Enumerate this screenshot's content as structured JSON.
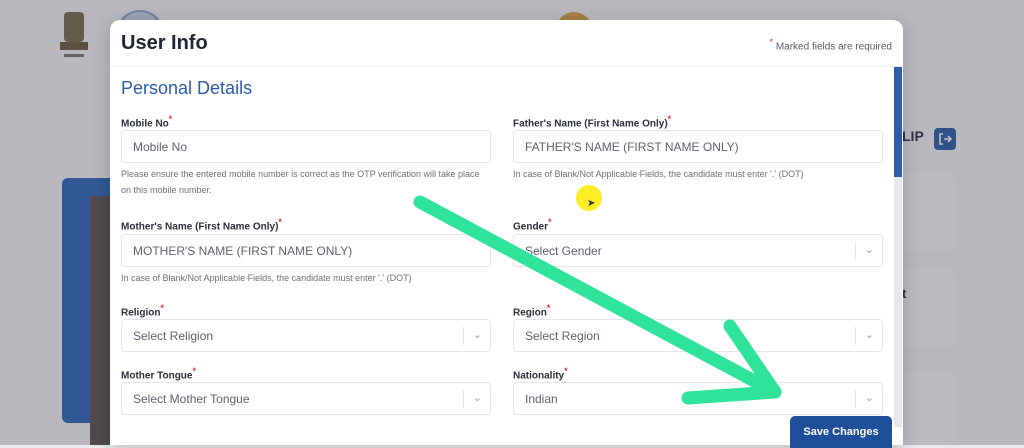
{
  "modal": {
    "title": "User Info",
    "required_note": "Marked fields are required",
    "required_star": "*"
  },
  "section": {
    "title": "Personal Details"
  },
  "fields": {
    "mobile": {
      "label": "Mobile No",
      "value": "Mobile No",
      "hint": "Please ensure the entered mobile number is correct as the OTP verification will take place on this mobile number."
    },
    "father": {
      "label": "Father's Name (First Name Only)",
      "value": "FATHER'S NAME (FIRST NAME ONLY)",
      "hint": "In case of Blank/Not Applicable Fields, the candidate must enter '.' (DOT)"
    },
    "mother": {
      "label": "Mother's Name (First Name Only)",
      "value": "MOTHER'S NAME (FIRST NAME ONLY)",
      "hint": "In case of Blank/Not Applicable Fields, the candidate must enter '.' (DOT)"
    },
    "gender": {
      "label": "Gender",
      "value": "Select Gender"
    },
    "religion": {
      "label": "Religion",
      "value": "Select Religion"
    },
    "region": {
      "label": "Region",
      "value": "Select Region"
    },
    "mother_tongue": {
      "label": "Mother Tongue",
      "value": "Select Mother Tongue"
    },
    "nationality": {
      "label": "Nationality",
      "value": "Indian"
    }
  },
  "save_button": {
    "label": "Save Changes"
  },
  "background": {
    "user_name_partial": "DILIP",
    "card_text_partial": "t"
  },
  "icons": {
    "chevron": "chevron-down-icon",
    "logout": "logout-icon",
    "cursor": "pointer-cursor-icon"
  },
  "colors": {
    "accent": "#2d5ca8",
    "button": "#1f4f9a",
    "annotation_arrow": "#2fe39a",
    "cursor_highlight": "#ffeb00"
  }
}
